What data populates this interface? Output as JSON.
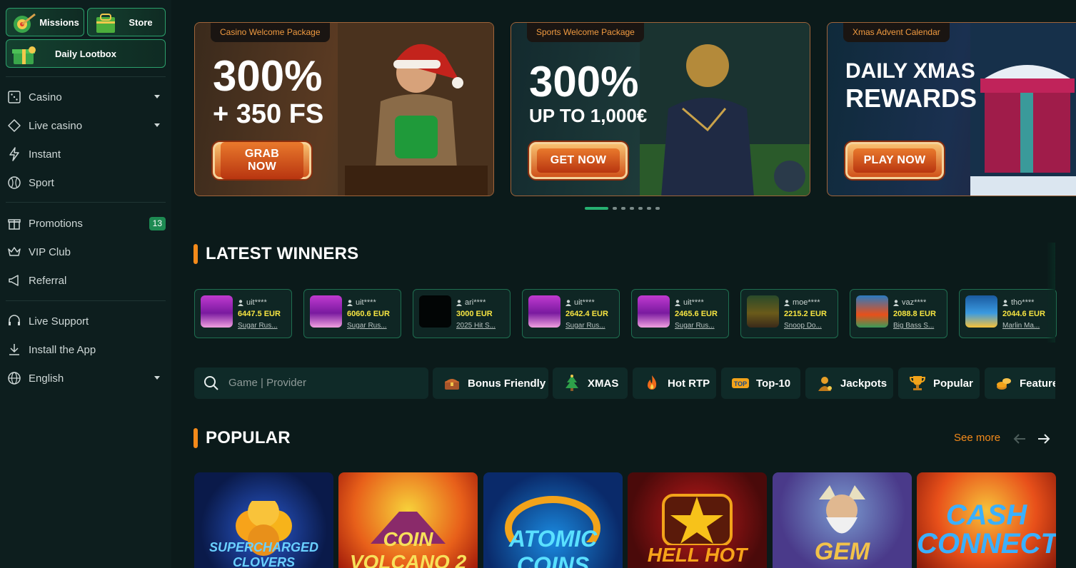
{
  "sidebar": {
    "missions_label": "Missions",
    "store_label": "Store",
    "lootbox_label": "Daily Lootbox",
    "nav": [
      {
        "label": "Casino",
        "icon": "dice-icon",
        "dropdown": true
      },
      {
        "label": "Live casino",
        "icon": "chip-icon",
        "dropdown": true
      },
      {
        "label": "Instant",
        "icon": "lightning-icon",
        "dropdown": false
      },
      {
        "label": "Sport",
        "icon": "ball-icon",
        "dropdown": false
      }
    ],
    "secondary": [
      {
        "label": "Promotions",
        "icon": "gift-icon",
        "badge": "13"
      },
      {
        "label": "VIP Club",
        "icon": "crown-icon"
      },
      {
        "label": "Referral",
        "icon": "megaphone-icon"
      }
    ],
    "footer": [
      {
        "label": "Live Support",
        "icon": "headset-icon"
      },
      {
        "label": "Install the App",
        "icon": "download-icon"
      },
      {
        "label": "English",
        "icon": "globe-icon",
        "dropdown": true
      }
    ]
  },
  "banners": [
    {
      "tag": "Casino Welcome Package",
      "line1": "300%",
      "line2": "+ 350 FS",
      "cta": "GRAB NOW"
    },
    {
      "tag": "Sports Welcome Package",
      "line1": "300%",
      "line2": "UP TO 1,000€",
      "cta": "GET NOW"
    },
    {
      "tag": "Xmas Advent Calendar",
      "line1": "DAILY XMAS",
      "line2": "REWARDS",
      "cta": "PLAY NOW"
    }
  ],
  "carousel": {
    "count": 7,
    "active": 0
  },
  "winners_title": "LATEST WINNERS",
  "winners": [
    {
      "user": "uit****",
      "amount": "6447.5 EUR",
      "game": "Sugar Rus..."
    },
    {
      "user": "uit****",
      "amount": "6060.6 EUR",
      "game": "Sugar Rus..."
    },
    {
      "user": "ari****",
      "amount": "3000 EUR",
      "game": "2025 Hit S..."
    },
    {
      "user": "uit****",
      "amount": "2642.4 EUR",
      "game": "Sugar Rus..."
    },
    {
      "user": "uit****",
      "amount": "2465.6 EUR",
      "game": "Sugar Rus..."
    },
    {
      "user": "moe****",
      "amount": "2215.2 EUR",
      "game": "Snoop Do..."
    },
    {
      "user": "vaz****",
      "amount": "2088.8 EUR",
      "game": "Big Bass S..."
    },
    {
      "user": "tho****",
      "amount": "2044.6 EUR",
      "game": "Marlin Ma..."
    }
  ],
  "search": {
    "placeholder": "Game | Provider"
  },
  "filters": [
    "Bonus Friendly",
    "XMAS",
    "Hot RTP",
    "Top-10",
    "Jackpots",
    "Popular",
    "Featured"
  ],
  "popular": {
    "title": "POPULAR",
    "see_more": "See more",
    "games": [
      {
        "name": "SUPERCHARGED CLOVERS"
      },
      {
        "name": "COIN VOLCANO 2"
      },
      {
        "name": "ATOMIC COINS"
      },
      {
        "name": "HELL HOT"
      },
      {
        "name": "GEM"
      },
      {
        "name": "CASH CONNECTION"
      }
    ]
  }
}
